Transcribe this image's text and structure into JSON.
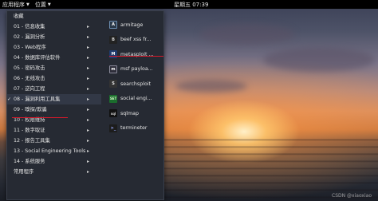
{
  "top_panel": {
    "apps_menu_label": "应用程序",
    "places_menu_label": "位置",
    "clock": "星期五 07:39"
  },
  "menu": {
    "categories": [
      {
        "label": "收藏"
      },
      {
        "label": "01 - 信息收集"
      },
      {
        "label": "02 - 漏洞分析"
      },
      {
        "label": "03 - Web程序"
      },
      {
        "label": "04 - 数据库评估软件"
      },
      {
        "label": "05 - 密码攻击"
      },
      {
        "label": "06 - 无线攻击"
      },
      {
        "label": "07 - 逆向工程"
      },
      {
        "label": "08 - 漏洞利用工具集"
      },
      {
        "label": "09 - 嗅探/欺骗"
      },
      {
        "label": "10 - 权限维持"
      },
      {
        "label": "11 - 数字取证"
      },
      {
        "label": "12 - 报告工具集"
      },
      {
        "label": "13 - Social Engineering Tools"
      },
      {
        "label": "14 - 系统服务"
      },
      {
        "label": "常用程序"
      }
    ],
    "selected_index": 8,
    "apps": [
      {
        "label": "armitage",
        "icon": "armitage-icon",
        "glyph": "A"
      },
      {
        "label": "beef xss fr...",
        "icon": "beef-icon",
        "glyph": "B"
      },
      {
        "label": "metasploit ...",
        "icon": "metasploit-icon",
        "glyph": "M"
      },
      {
        "label": "msf payloa...",
        "icon": "msf-payload-icon",
        "glyph": "m"
      },
      {
        "label": "searchsploit",
        "icon": "searchsploit-icon",
        "glyph": "S"
      },
      {
        "label": "social engi...",
        "icon": "set-icon",
        "glyph": "SET"
      },
      {
        "label": "sqlmap",
        "icon": "sqlmap-icon",
        "glyph": "sql"
      },
      {
        "label": "termineter",
        "icon": "termineter-icon",
        "glyph": ">_"
      }
    ]
  },
  "watermark": "CSDN @xiaoxiao",
  "colors": {
    "panel": "#000000",
    "menu_bg": "#262a33",
    "highlight_underline": "#d7192a"
  }
}
